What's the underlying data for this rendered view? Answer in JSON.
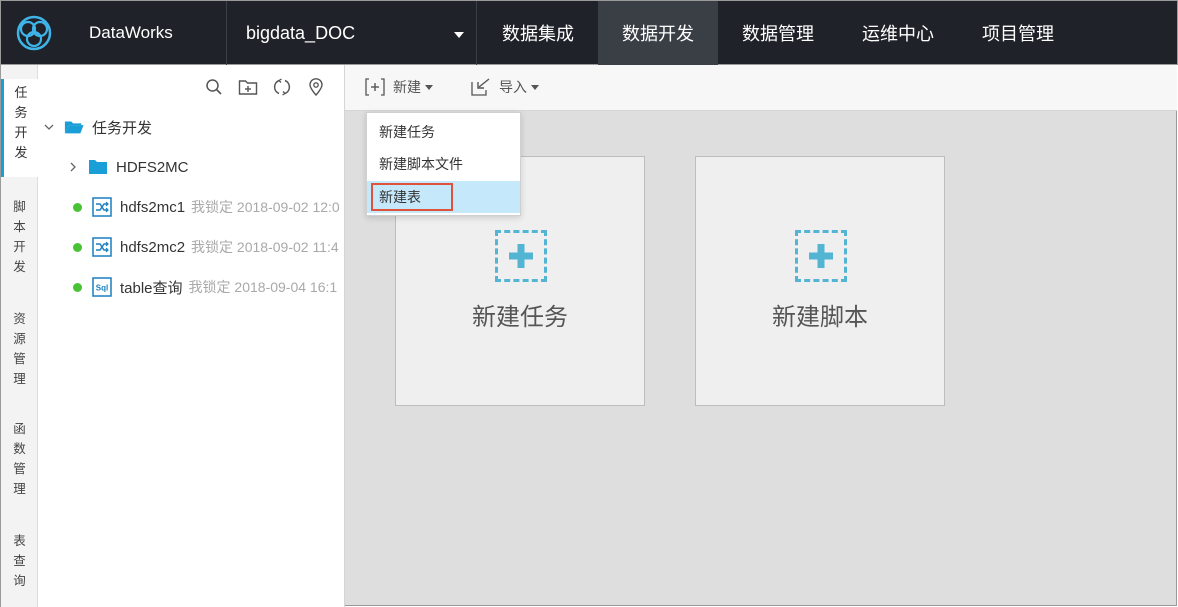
{
  "brand": {
    "name": "DataWorks",
    "logo_icon": "dataworks-logo-icon"
  },
  "project": {
    "name": "bigdata_DOC"
  },
  "nav": {
    "items": [
      {
        "label": "数据集成",
        "active": false
      },
      {
        "label": "数据开发",
        "active": true
      },
      {
        "label": "数据管理",
        "active": false
      },
      {
        "label": "运维中心",
        "active": false
      },
      {
        "label": "项目管理",
        "active": false
      }
    ]
  },
  "side_tabs": [
    {
      "label": "任务开发",
      "active": true
    },
    {
      "label": "脚本开发",
      "active": false
    },
    {
      "label": "资源管理",
      "active": false
    },
    {
      "label": "函数管理",
      "active": false
    },
    {
      "label": "表查询",
      "active": false
    }
  ],
  "tree": {
    "toolbar_icons": [
      "search-icon",
      "new-folder-icon",
      "refresh-icon",
      "locate-icon"
    ],
    "root": {
      "label": "任务开发",
      "icon": "folder-open-icon"
    },
    "folder": {
      "label": "HDFS2MC",
      "icon": "folder-icon"
    },
    "nodes": [
      {
        "name": "hdfs2mc1",
        "meta": "我锁定 2018-09-02 12:0",
        "icon": "sync-node-icon",
        "status_color": "#49c235"
      },
      {
        "name": "hdfs2mc2",
        "meta": "我锁定 2018-09-02 11:4",
        "icon": "sync-node-icon",
        "status_color": "#49c235"
      },
      {
        "name": "table查询",
        "meta": "我锁定 2018-09-04 16:1",
        "icon": "sql-node-icon",
        "status_color": "#49c235"
      }
    ]
  },
  "toolbar": {
    "new_label": "新建",
    "import_label": "导入"
  },
  "cards": [
    {
      "label": "新建任务",
      "icon": "plus-icon"
    },
    {
      "label": "新建脚本",
      "icon": "plus-icon"
    }
  ],
  "menu": {
    "items": [
      {
        "label": "新建任务",
        "highlighted": false
      },
      {
        "label": "新建脚本文件",
        "highlighted": false
      },
      {
        "label": "新建表",
        "highlighted": true
      }
    ]
  },
  "colors": {
    "topbar": "#1f2329",
    "accent": "#1a9ed8",
    "status_ok": "#49c235",
    "highlight": "#c5e8fb",
    "callout": "#e0533a"
  }
}
